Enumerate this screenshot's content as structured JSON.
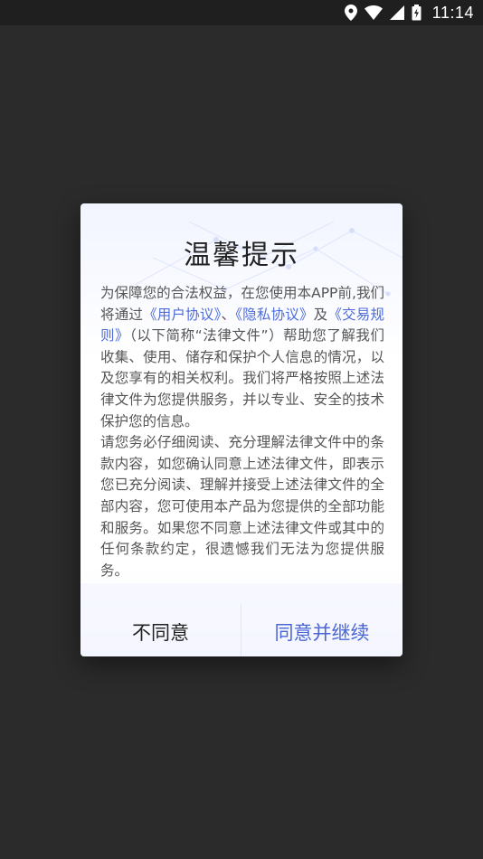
{
  "status_bar": {
    "time": "11:14",
    "icons": [
      "location-icon",
      "wifi-icon",
      "signal-icon",
      "battery-charging-icon"
    ]
  },
  "dialog": {
    "title": "温馨提示",
    "paragraph1": {
      "lead": "为保障您的合法权益，在您使用本APP前,我们将通过",
      "link_user": "《用户协议》",
      "sep1": "、",
      "link_privacy": "《隐私协议》",
      "sep2": "及",
      "link_rules": "《交易规则》",
      "rest": "（以下简称“法律文件”）帮助您了解我们收集、使用、储存和保护个人信息的情况，以及您享有的相关权利。我们将严格按照上述法律文件为您提供服务，并以专业、安全的技术保护您的信息。"
    },
    "paragraph2": "请您务必仔细阅读、充分理解法律文件中的条款内容，如您确认同意上述法律文件，即表示您已充分阅读、理解并接受上述法律文件的全部内容，您可使用本产品为您提供的全部功能和服务。如果您不同意上述法律文件或其中的任何条款约定，很遗憾我们无法为您提供服务。",
    "buttons": {
      "disagree": "不同意",
      "agree": "同意并继续"
    }
  },
  "colors": {
    "link": "#4d6bdb",
    "agree_button": "#4a66d6",
    "backdrop": "#2b2b2b"
  }
}
